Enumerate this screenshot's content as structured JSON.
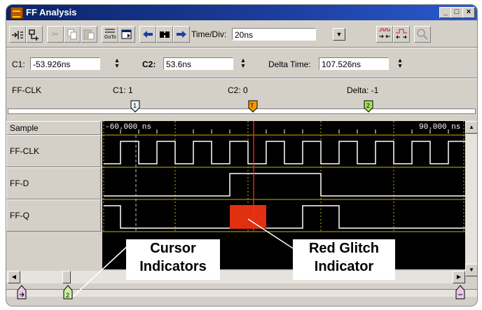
{
  "window": {
    "title": "FF Analysis",
    "controls": {
      "minimize": "_",
      "maximize": "□",
      "close": "×"
    }
  },
  "toolbar": {
    "timediv_label": "Time/Div:",
    "timediv_value": "20ns",
    "icons": [
      "link-fit-icon",
      "add-signal-icon",
      "cut-icon",
      "copy-icon",
      "paste-icon",
      "goto-icon",
      "properties-icon",
      "left-arrow-icon",
      "find-icon",
      "right-arrow-icon",
      "zoom-in-icon",
      "zoom-out-icon",
      "magnify-icon"
    ]
  },
  "cursors": {
    "c1_label": "C1:",
    "c1_value": "-53.926ns",
    "c2_label": "C2:",
    "c2_value": "53.6ns",
    "delta_label": "Delta Time:",
    "delta_value": "107.526ns"
  },
  "info": {
    "signal": "FF-CLK",
    "c1": "C1: 1",
    "c2": "C2: 0",
    "delta": "Delta: -1"
  },
  "ruler": {
    "marker1": "1",
    "marker_t": "T",
    "marker2": "2"
  },
  "signals": {
    "header": "Sample",
    "names": [
      "FF-CLK",
      "FF-D",
      "FF-Q"
    ]
  },
  "waveform": {
    "time_start_label": "-60.000 ns",
    "time_end_label": "90.000 ns",
    "colors": {
      "background": "#000000",
      "trace": "#ffffff",
      "grid": "#c8b400",
      "glitch": "#e03010",
      "trigger": "#ff2a2a",
      "cursor": "#9ecbe0"
    }
  },
  "bottom_markers": {
    "marker2": "2"
  },
  "callouts": {
    "cursor": [
      "Cursor",
      "Indicators"
    ],
    "glitch": [
      "Red Glitch",
      "Indicator"
    ]
  }
}
